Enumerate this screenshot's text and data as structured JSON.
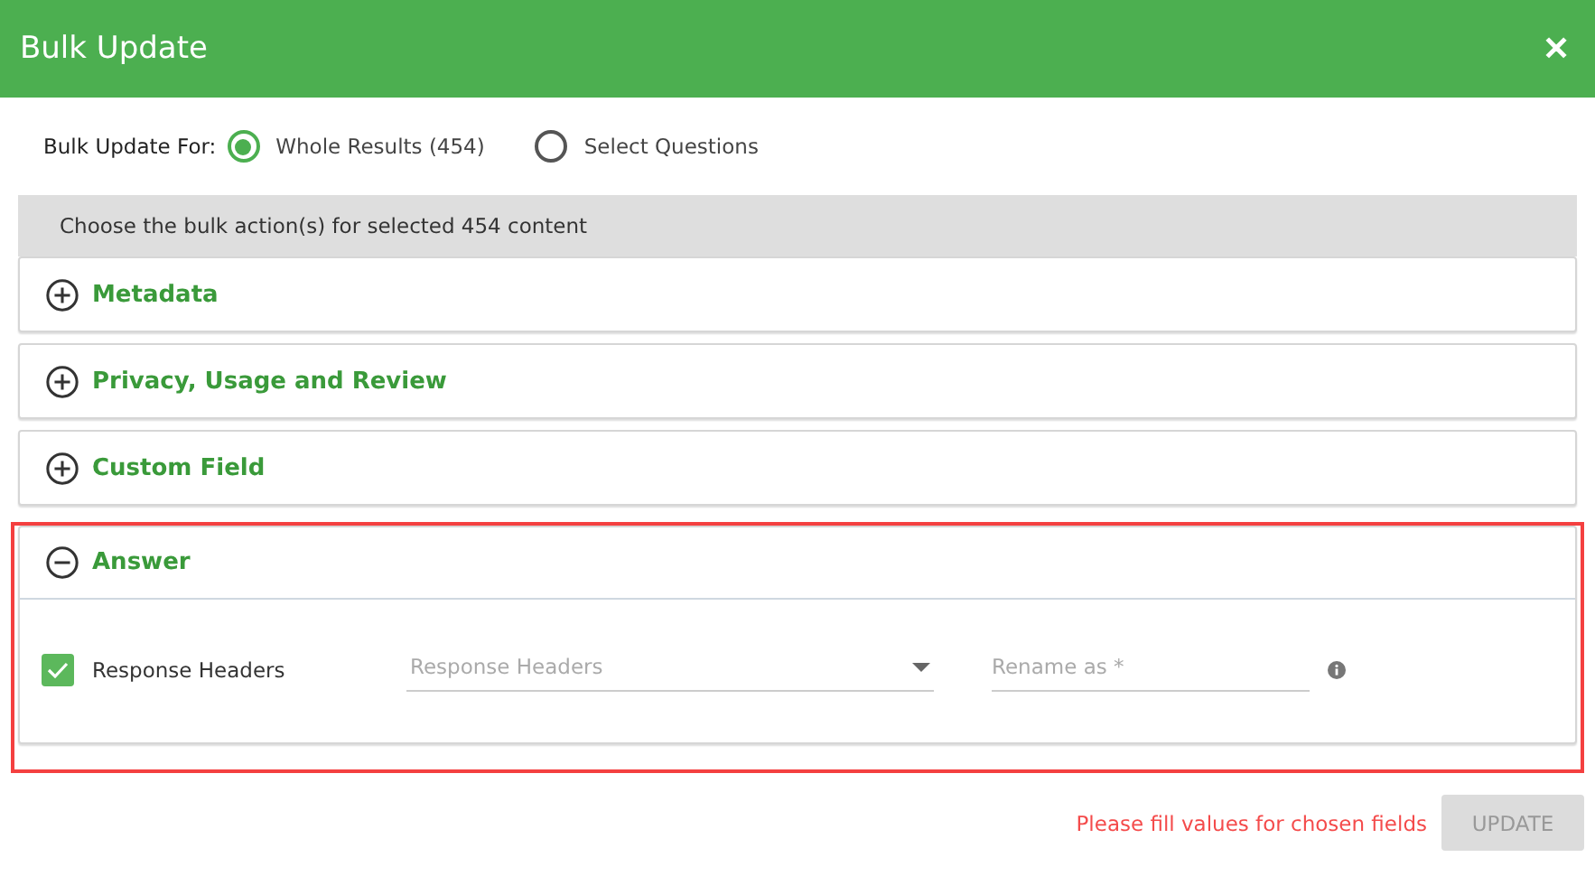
{
  "dialog": {
    "title": "Bulk Update",
    "close": "✕"
  },
  "scope": {
    "label": "Bulk Update For:",
    "options": [
      {
        "label": "Whole Results (454)",
        "selected": true
      },
      {
        "label": "Select Questions",
        "selected": false
      }
    ]
  },
  "banner": "Choose the bulk action(s) for selected 454 content",
  "sections": [
    {
      "title": "Metadata",
      "expanded": false,
      "highlighted": false
    },
    {
      "title": "Privacy, Usage and Review",
      "expanded": false,
      "highlighted": false
    },
    {
      "title": "Custom Field",
      "expanded": false,
      "highlighted": false
    },
    {
      "title": "Answer",
      "expanded": true,
      "highlighted": true,
      "fields": [
        {
          "label": "Response Headers",
          "checked": true,
          "select_placeholder": "Response Headers",
          "rename_placeholder": "Rename as *"
        }
      ]
    }
  ],
  "footer": {
    "error": "Please fill values for chosen fields",
    "button": "UPDATE",
    "button_disabled": true
  }
}
